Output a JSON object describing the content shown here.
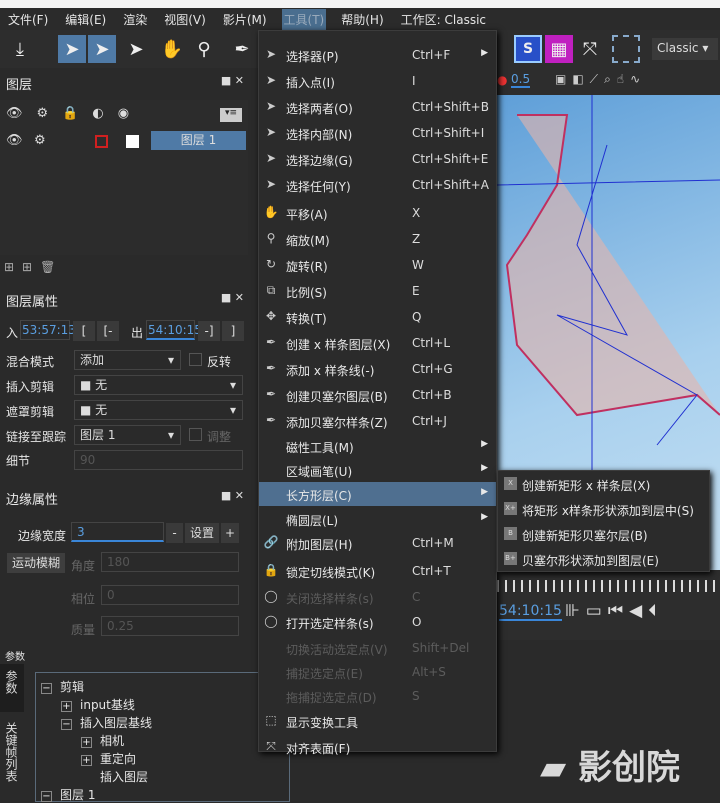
{
  "menubar": {
    "items": [
      "文件(F)",
      "编辑(E)",
      "渲染",
      "视图(V)",
      "影片(M)",
      "工具(T)",
      "帮助(H)",
      "工作区: Classic"
    ]
  },
  "toolbar": {
    "workspace": "Classic",
    "opacity": "0.5"
  },
  "layers_panel": {
    "title": "图层",
    "layer_name": "图层 1"
  },
  "layer_props": {
    "title": "图层属性",
    "in_label": "入",
    "in_value": "53:57:13",
    "out_label": "出",
    "out_value": "54:10:15",
    "blend_label": "混合模式",
    "blend_value": "添加",
    "invert_label": "反转",
    "insert_clip_label": "插入剪辑",
    "insert_clip_value": "无",
    "matte_clip_label": "遮罩剪辑",
    "matte_clip_value": "无",
    "link_track_label": "链接至跟踪",
    "link_track_value": "图层 1",
    "adjust_label": "调整",
    "detail_label": "细节",
    "detail_value": "90"
  },
  "edge_props": {
    "title": "边缘属性",
    "width_label": "边缘宽度",
    "width_value": "3",
    "minus": "-",
    "set": "设置",
    "plus": "+",
    "motion_blur": "运动模糊",
    "angle_label": "角度",
    "angle_value": "180",
    "phase_label": "相位",
    "phase_value": "0",
    "quality_label": "质量",
    "quality_value": "0.25"
  },
  "params": {
    "title": "参数",
    "tabs": [
      "参数",
      "关键帧列表"
    ],
    "tree": [
      "剪辑",
      "input基线",
      "插入图层基线",
      "相机",
      "重定向",
      "插入图层",
      "图层 1"
    ]
  },
  "tools_menu": [
    {
      "label": "选择器(P)",
      "key": "Ctrl+F",
      "icon": "arrow",
      "sub": true
    },
    {
      "label": "插入点(I)",
      "key": "I",
      "icon": "arrow-plus"
    },
    {
      "label": "选择两者(O)",
      "key": "Ctrl+Shift+B",
      "icon": "arrow"
    },
    {
      "label": "选择内部(N)",
      "key": "Ctrl+Shift+I",
      "icon": "arrow"
    },
    {
      "label": "选择边缘(G)",
      "key": "Ctrl+Shift+E",
      "icon": "arrow"
    },
    {
      "label": "选择任何(Y)",
      "key": "Ctrl+Shift+A",
      "icon": "arrow"
    },
    {
      "label": "平移(A)",
      "key": "X",
      "icon": "hand"
    },
    {
      "label": "缩放(M)",
      "key": "Z",
      "icon": "magnifier"
    },
    {
      "label": "旋转(R)",
      "key": "W",
      "icon": "rotate"
    },
    {
      "label": "比例(S)",
      "key": "E",
      "icon": "scale"
    },
    {
      "label": "转换(T)",
      "key": "Q",
      "icon": "move"
    },
    {
      "label": "创建 x 样条图层(X)",
      "key": "Ctrl+L",
      "icon": "pen"
    },
    {
      "label": "添加 x 样条线(-)",
      "key": "Ctrl+G",
      "icon": "pen"
    },
    {
      "label": "创建贝塞尔图层(B)",
      "key": "Ctrl+B",
      "icon": "pen"
    },
    {
      "label": "添加贝塞尔样条(Z)",
      "key": "Ctrl+J",
      "icon": "pen"
    },
    {
      "label": "磁性工具(M)",
      "key": "",
      "icon": "",
      "sub": true
    },
    {
      "label": "区域画笔(U)",
      "key": "",
      "icon": "",
      "sub": true
    },
    {
      "label": "长方形层(C)",
      "key": "",
      "icon": "",
      "sub": true,
      "hl": true
    },
    {
      "label": "椭圆层(L)",
      "key": "",
      "icon": "",
      "sub": true
    },
    {
      "label": "附加图层(H)",
      "key": "Ctrl+M",
      "icon": "link"
    },
    {
      "label": "锁定切线模式(K)",
      "key": "Ctrl+T",
      "icon": "lock"
    },
    {
      "label": "关闭选择样条(s)",
      "key": "C",
      "icon": "circle",
      "dis": true
    },
    {
      "label": "打开选定样条(s)",
      "key": "O",
      "icon": "circle"
    },
    {
      "label": "切换活动选定点(V)",
      "key": "Shift+Del",
      "icon": "",
      "dis": true
    },
    {
      "label": "捕捉选定点(E)",
      "key": "Alt+S",
      "icon": "",
      "dis": true
    },
    {
      "label": "拖捕捉选定点(D)",
      "key": "S",
      "icon": "",
      "dis": true
    },
    {
      "label": "显示变换工具",
      "key": "",
      "icon": "transform"
    },
    {
      "label": "对齐表面(F)",
      "key": "",
      "icon": "align"
    }
  ],
  "rect_submenu": [
    {
      "label": "创建新矩形 x 样条层(X)",
      "icon": "X"
    },
    {
      "label": "将矩形 x样条形状添加到层中(S)",
      "icon": "X+"
    },
    {
      "label": "创建新矩形贝塞尔层(B)",
      "icon": "B"
    },
    {
      "label": "贝塞尔形状添加到图层(E)",
      "icon": "B+"
    }
  ],
  "timeline": {
    "time": "54:10:15"
  },
  "watermark": "影创院"
}
